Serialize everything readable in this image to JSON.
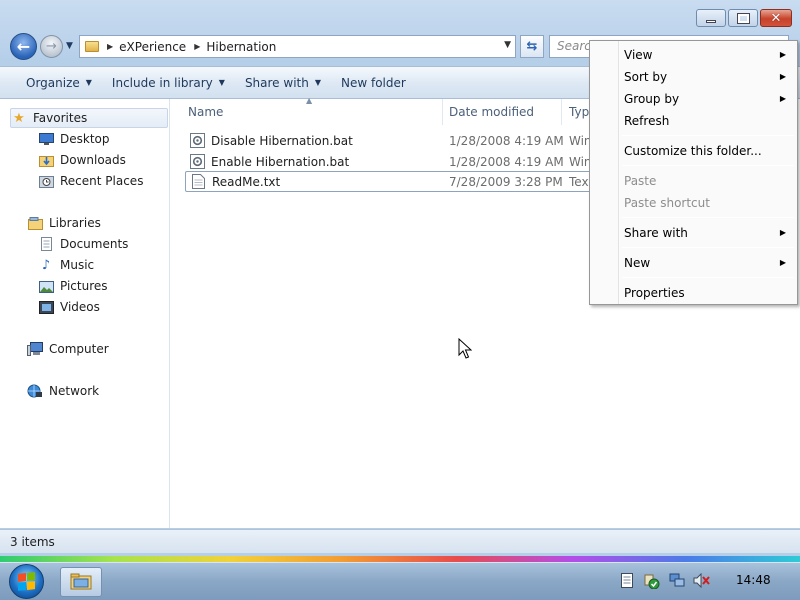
{
  "address_bar": {
    "crumbs": [
      "eXPerience",
      "Hibernation"
    ]
  },
  "search": {
    "placeholder": "Search"
  },
  "command_bar": {
    "organize": "Organize",
    "include_in_library": "Include in library",
    "share_with": "Share with",
    "new_folder": "New folder"
  },
  "nav_pane": {
    "favorites": "Favorites",
    "desktop": "Desktop",
    "downloads": "Downloads",
    "recent_places": "Recent Places",
    "libraries": "Libraries",
    "documents": "Documents",
    "music": "Music",
    "pictures": "Pictures",
    "videos": "Videos",
    "computer": "Computer",
    "network": "Network"
  },
  "columns": {
    "name": "Name",
    "date_modified": "Date modified",
    "type": "Typ"
  },
  "files": [
    {
      "name": "Disable Hibernation.bat",
      "date": "1/28/2008 4:19 AM",
      "type": "Win",
      "icon": "batch-file-icon"
    },
    {
      "name": "Enable Hibernation.bat",
      "date": "1/28/2008 4:19 AM",
      "type": "Win",
      "icon": "batch-file-icon"
    },
    {
      "name": "ReadMe.txt",
      "date": "7/28/2009 3:28 PM",
      "type": "Text",
      "icon": "text-file-icon"
    }
  ],
  "status_bar": {
    "item_count": "3 items"
  },
  "context_menu": {
    "view": "View",
    "sort_by": "Sort by",
    "group_by": "Group by",
    "refresh": "Refresh",
    "customize": "Customize this folder...",
    "paste": "Paste",
    "paste_shortcut": "Paste shortcut",
    "share_with": "Share with",
    "new": "New",
    "properties": "Properties"
  },
  "taskbar": {
    "clock": "14:48"
  },
  "colors": {
    "accent": "#2a63b8",
    "close_button": "#c7422a",
    "command_text": "#1e395b"
  }
}
